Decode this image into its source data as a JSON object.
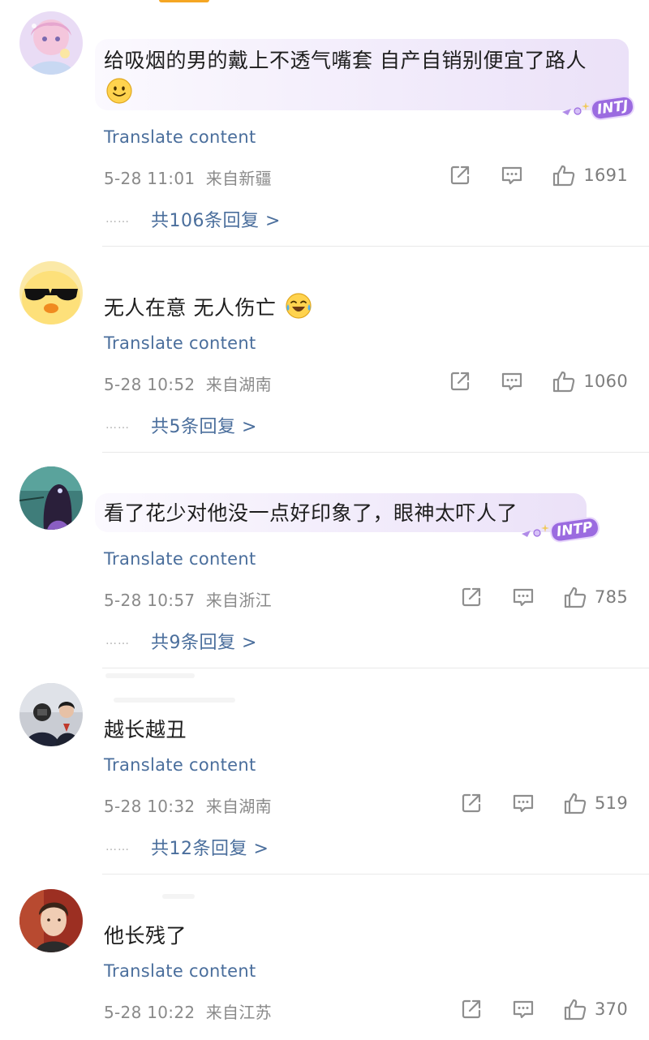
{
  "colors": {
    "tab_indicator": "#f5a623",
    "link": "#4a6e9c",
    "meta_gray": "#8a8a8a",
    "icon_gray": "#8e8e8e",
    "badge_purple": "#9b6be0"
  },
  "translate_label": "Translate content",
  "comments": [
    {
      "text": "给吸烟的男的戴上不透气嘴套 自产自销别便宜了路人",
      "emoji": "smile-emoji",
      "badge": "INTJ",
      "datetime": "5-28 11:01",
      "location": "来自新疆",
      "likes": "1691",
      "replies_label": "共106条回复 >"
    },
    {
      "text": "无人在意 无人伤亡",
      "emoji": "laugh-cry-emoji",
      "badge": "",
      "datetime": "5-28 10:52",
      "location": "来自湖南",
      "likes": "1060",
      "replies_label": "共5条回复 >"
    },
    {
      "text": "看了花少对他没一点好印象了，眼神太吓人了",
      "emoji": "",
      "badge": "INTP",
      "datetime": "5-28 10:57",
      "location": "来自浙江",
      "likes": "785",
      "replies_label": "共9条回复 >"
    },
    {
      "text": "越长越丑",
      "emoji": "",
      "badge": "",
      "datetime": "5-28 10:32",
      "location": "来自湖南",
      "likes": "519",
      "replies_label": "共12条回复 >"
    },
    {
      "text": "他长残了",
      "emoji": "",
      "badge": "",
      "datetime": "5-28 10:22",
      "location": "来自江苏",
      "likes": "370",
      "replies_label": ""
    }
  ],
  "reply_dots": "……"
}
